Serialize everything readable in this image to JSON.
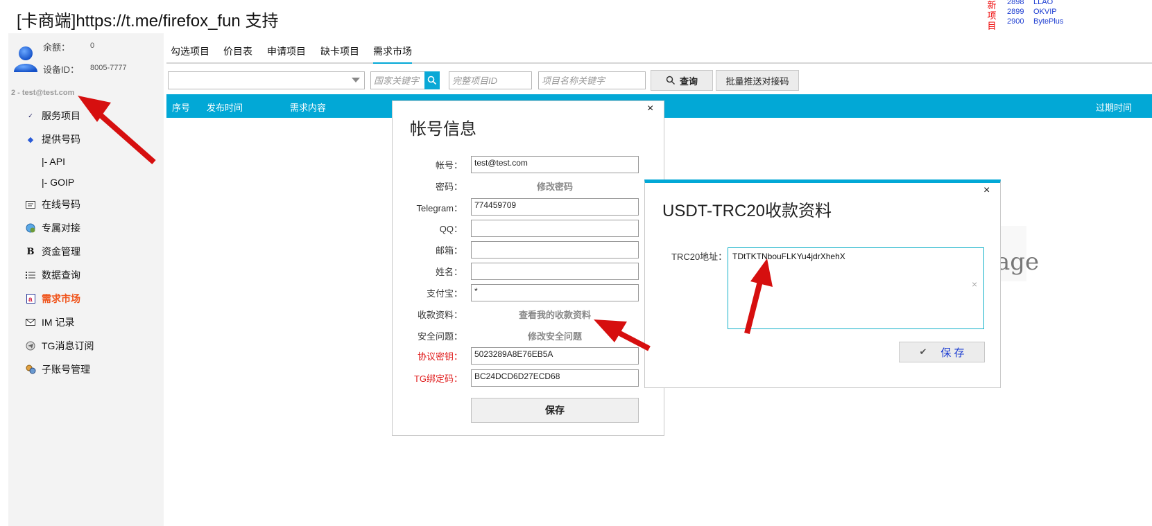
{
  "header": {
    "title": "[卡商端]https://t.me/firefox_fun 支持",
    "new_label": "新项目",
    "new_projects": [
      {
        "id": "2898",
        "name": "LLAO"
      },
      {
        "id": "2899",
        "name": "OKVIP"
      },
      {
        "id": "2900",
        "name": "BytePlus"
      }
    ]
  },
  "sidebar": {
    "balance_label": "余额：",
    "balance_value": "0",
    "device_label": "设备ID：",
    "device_value": "8005-7777",
    "account_line": "2 - test@test.com",
    "items": [
      {
        "label": "服务项目",
        "icon": "abc-check-icon"
      },
      {
        "label": "提供号码",
        "icon": "arrow-icon"
      },
      {
        "label": "|-  API",
        "icon": ""
      },
      {
        "label": "|-  GOIP",
        "icon": ""
      },
      {
        "label": "在线号码",
        "icon": "card-icon"
      },
      {
        "label": "专属对接",
        "icon": "globe-user-icon"
      },
      {
        "label": "资金管理",
        "icon": "bitcoin-icon"
      },
      {
        "label": "数据查询",
        "icon": "list-icon"
      },
      {
        "label": "需求市场",
        "icon": "market-icon"
      },
      {
        "label": "IM 记录",
        "icon": "mail-icon"
      },
      {
        "label": "TG消息订阅",
        "icon": "telegram-icon"
      },
      {
        "label": "子账号管理",
        "icon": "users-icon"
      }
    ]
  },
  "tabs": [
    "勾选项目",
    "价目表",
    "申请项目",
    "缺卡项目",
    "需求市场"
  ],
  "toolbar": {
    "country_placeholder": "国家关键字",
    "project_id_placeholder": "完整项目ID",
    "project_name_placeholder": "项目名称关键字",
    "query_label": "查询",
    "batch_label": "批量推送对接码"
  },
  "table": {
    "headers": [
      "序号",
      "发布时间",
      "需求内容",
      "过期时间"
    ]
  },
  "watermark_text": "age",
  "account_dialog": {
    "title": "帐号信息",
    "close": "×",
    "account_label": "帐号：",
    "account_value": "test@test.com",
    "password_label": "密码：",
    "password_link": "修改密码",
    "telegram_label": "Telegram：",
    "telegram_value": "774459709",
    "qq_label": "QQ：",
    "qq_value": "",
    "email_label": "邮箱：",
    "email_value": "",
    "name_label": "姓名：",
    "name_value": "",
    "alipay_label": "支付宝：",
    "alipay_value": "*",
    "payment_label": "收款资料：",
    "payment_link": "查看我的收款资料",
    "security_label": "安全问题：",
    "security_link": "修改安全问题",
    "protocol_label": "协议密钥：",
    "protocol_value": "5023289A8E76EB5A",
    "tg_bind_label": "TG绑定码：",
    "tg_bind_value": "BC24DCD6D27ECD68",
    "save_label": "保存"
  },
  "usdt_dialog": {
    "title": "USDT-TRC20收款资料",
    "close": "×",
    "address_label": "TRC20地址：",
    "address_value": "TDtTKTNbouFLKYu4jdrXhehX",
    "clear": "×",
    "save_label": "保 存"
  },
  "colors": {
    "accent": "#02a8d6",
    "active_nav": "#f0531a",
    "new_label": "#e00000",
    "arrow": "#d60f0f"
  }
}
